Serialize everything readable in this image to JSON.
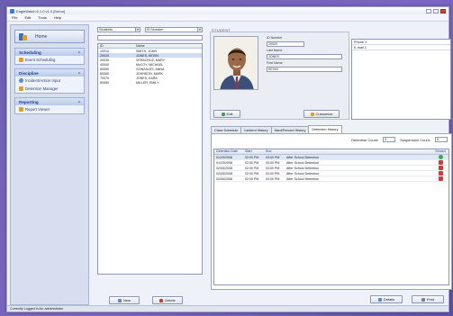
{
  "window": {
    "title": "EagleWatch 6.1.0 v1.0  [Demo]"
  },
  "menu": [
    "File",
    "Edit",
    "Tools",
    "Help"
  ],
  "sidebar": {
    "home_label": "Home",
    "sections": [
      {
        "title": "Scheduling",
        "items": [
          "Event Scheduling"
        ]
      },
      {
        "title": "Discipline",
        "items": [
          "Incident/Action Input",
          "Detention Manager"
        ]
      },
      {
        "title": "Reporting",
        "items": [
          "Report Viewer"
        ]
      }
    ]
  },
  "students": {
    "filter_type": "Students",
    "filter_field": "ID Number",
    "columns": [
      "ID",
      "Name"
    ],
    "rows": [
      {
        "id": "10010",
        "name": "SMITH, JOHN"
      },
      {
        "id": "20020",
        "name": "JONES, KEVIN"
      },
      {
        "id": "30030",
        "name": "VERACRUZ, MARY"
      },
      {
        "id": "40040",
        "name": "McCOY, MICHAEL"
      },
      {
        "id": "50050",
        "name": "GONZALES, ANNA"
      },
      {
        "id": "60060",
        "name": "JOHNSON, MARK"
      },
      {
        "id": "70070",
        "name": "JONES, KARA"
      },
      {
        "id": "80080",
        "name": "MILLER, EMILY"
      }
    ],
    "selected_index": 1,
    "new_label": "New",
    "delete_label": "Delete"
  },
  "student_panel": {
    "title": "STUDENT",
    "id_label": "ID Number",
    "id_value": "20020",
    "last_label": "Last Name",
    "last_value": "JONES",
    "first_label": "First Name",
    "first_value": "KEVIN",
    "edit_label": "Edit",
    "customize_label": "Customize"
  },
  "contact": {
    "rows": [
      "Phone 1",
      "E-mail 1"
    ]
  },
  "tabs": [
    "Class Schedule",
    "Incident History",
    "Hard/Fenced History",
    "Detention History"
  ],
  "active_tab": 3,
  "counts": {
    "detention_label": "Detention Count:",
    "detention_value": "5",
    "suspension_label": "Suspension Count:",
    "suspension_value": "0"
  },
  "detentions": {
    "columns": [
      "Detention Date",
      "Start",
      "End",
      "",
      "Served"
    ],
    "rows": [
      {
        "date": "01/25/2008",
        "start": "02:00 PM",
        "end": "03:00 PM",
        "type": "After School Detention",
        "served": "served"
      },
      {
        "date": "01/23/2008",
        "start": "02:00 PM",
        "end": "03:00 PM",
        "type": "After School Detention",
        "served": "x"
      },
      {
        "date": "02/05/2008",
        "start": "02:00 PM",
        "end": "03:00 PM",
        "type": "After School Detention",
        "served": "x"
      },
      {
        "date": "02/05/2008",
        "start": "02:00 PM",
        "end": "03:00 PM",
        "type": "After School Detention",
        "served": "x"
      },
      {
        "date": "02/06/2008",
        "start": "02:00 PM",
        "end": "03:00 PM",
        "type": "After School Detention",
        "served": "x"
      }
    ]
  },
  "footer_buttons": {
    "details": "Details",
    "print": "Print"
  },
  "status_text": "Currently Logged In As: administrator",
  "colors": {
    "accent": "#2b3f78",
    "served": "#3aa84a",
    "not_served": "#d23a3a",
    "selection": "#cfdcf4"
  }
}
